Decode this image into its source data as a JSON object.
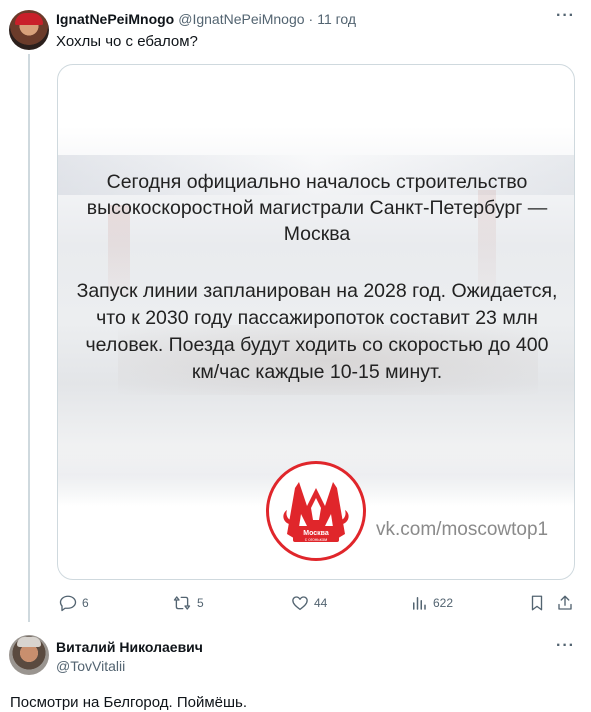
{
  "tweet1": {
    "author_name": "IgnatNePeiMnogo",
    "author_handle": "@IgnatNePeiMnogo",
    "separator": "·",
    "time": "11 год",
    "text": "Хохлы чо с ебалом?",
    "more": "···",
    "media": {
      "heading": "Сегодня официально началось строительство высокоскоростной магистрали Санкт-Петербург — Москва",
      "body": "Запуск линии запланирован на 2028 год. Ожидается, что к 2030 году пассажиропоток составит 23 млн человек. Поезда будут ходить со скоростью до 400 км/час каждые 10-15 минут.",
      "logo_text_line1": "Москва",
      "logo_text_line2": "с огоньком",
      "watermark": "vk.com/moscowtop1",
      "logo_color": "#e0262b"
    },
    "actions": {
      "replies": "6",
      "retweets": "5",
      "likes": "44",
      "views": "622"
    }
  },
  "tweet2": {
    "author_name": "Виталий Николаевич",
    "author_handle": "@TovVitalii",
    "more": "···",
    "text": "Посмотри на Белгород. Поймёшь."
  },
  "icons": {
    "reply": "reply-icon",
    "retweet": "retweet-icon",
    "like": "heart-icon",
    "views": "views-icon",
    "bookmark": "bookmark-icon",
    "share": "share-icon"
  },
  "colors": {
    "text_primary": "#0f1419",
    "text_secondary": "#536471",
    "border": "#cfd9de"
  }
}
